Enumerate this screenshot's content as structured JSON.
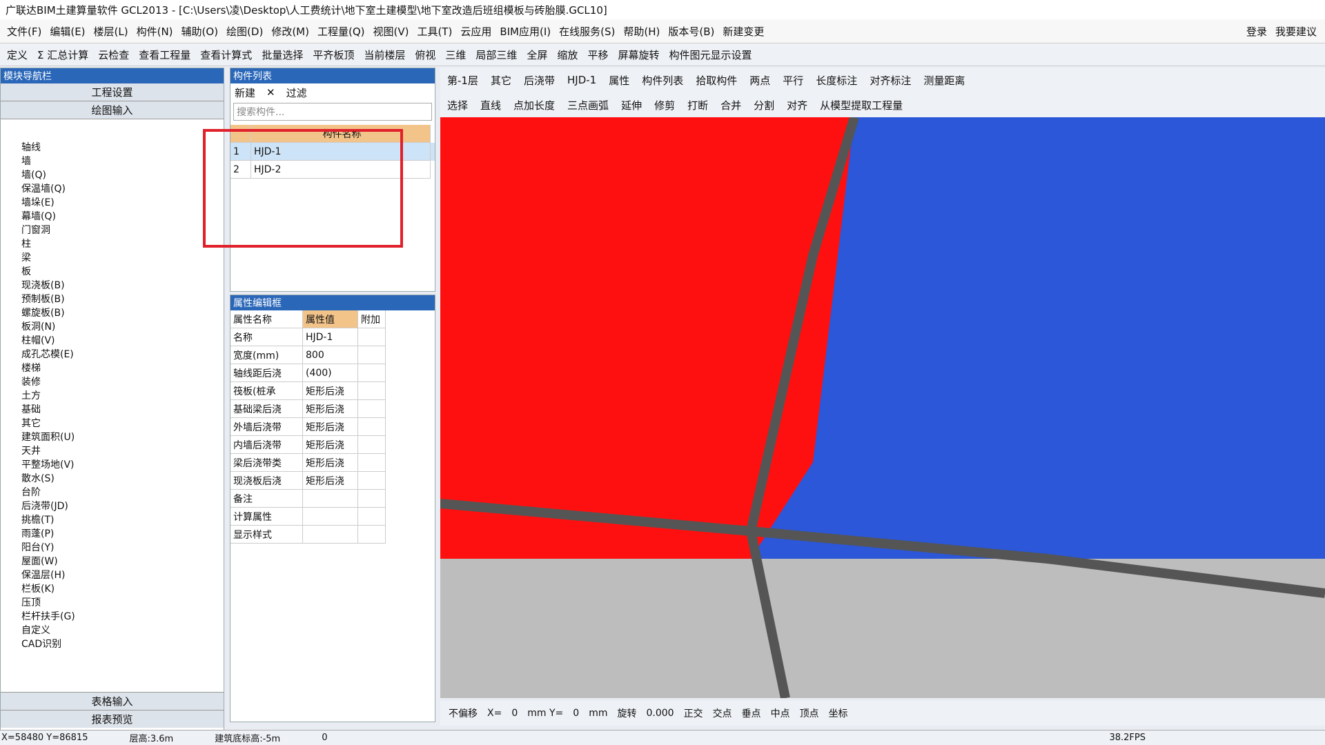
{
  "title": "广联达BIM土建算量软件 GCL2013 - [C:\\Users\\凌\\Desktop\\人工费统计\\地下室土建模型\\地下室改造后班组模板与砖胎膜.GCL10]",
  "menu": [
    "文件(F)",
    "编辑(E)",
    "楼层(L)",
    "构件(N)",
    "辅助(O)",
    "绘图(D)",
    "修改(M)",
    "工程量(Q)",
    "视图(V)",
    "工具(T)",
    "云应用",
    "BIM应用(I)",
    "在线服务(S)",
    "帮助(H)",
    "版本号(B)",
    "新建变更"
  ],
  "right_menu": {
    "login": "登录",
    "suggest": "我要建议"
  },
  "toolbar": [
    "定义",
    "Σ 汇总计算",
    "云检查",
    "查看工程量",
    "查看计算式",
    "批量选择",
    "平齐板顶",
    "当前楼层",
    "俯视",
    "三维",
    "局部三维",
    "全屏",
    "缩放",
    "平移",
    "屏幕旋转",
    "构件图元显示设置"
  ],
  "nav": {
    "header": "模块导航栏",
    "btn1": "工程设置",
    "btn2": "绘图输入",
    "items": [
      "轴线",
      "墙",
      "墙(Q)",
      "保温墙(Q)",
      "墙垛(E)",
      "幕墙(Q)",
      "门窗洞",
      "柱",
      "梁",
      "板",
      "现浇板(B)",
      "预制板(B)",
      "螺旋板(B)",
      "板洞(N)",
      "柱帽(V)",
      "成孔芯模(E)",
      "楼梯",
      "装修",
      "土方",
      "基础",
      "其它",
      "建筑面积(U)",
      "天井",
      "平整场地(V)",
      "散水(S)",
      "台阶",
      "后浇带(JD)",
      "挑檐(T)",
      "雨蓬(P)",
      "阳台(Y)",
      "屋面(W)",
      "保温层(H)",
      "栏板(K)",
      "压顶",
      "栏杆扶手(G)",
      "自定义",
      "CAD识别"
    ],
    "btn3": "表格输入",
    "btn4": "报表预览"
  },
  "comp": {
    "header": "构件列表",
    "new": "新建",
    "filter": "过滤",
    "search": "搜索构件...",
    "col": "构件名称",
    "rows": [
      {
        "n": "1",
        "v": "HJD-1"
      },
      {
        "n": "2",
        "v": "HJD-2"
      }
    ]
  },
  "prop": {
    "header": "属性编辑框",
    "cols": [
      "属性名称",
      "属性值",
      "附加"
    ],
    "rows": [
      [
        "名称",
        "HJD-1"
      ],
      [
        "宽度(mm)",
        "800"
      ],
      [
        "轴线距后浇",
        "(400)"
      ],
      [
        "筏板(桩承",
        "矩形后浇"
      ],
      [
        "基础梁后浇",
        "矩形后浇"
      ],
      [
        "外墙后浇带",
        "矩形后浇"
      ],
      [
        "内墙后浇带",
        "矩形后浇"
      ],
      [
        "梁后浇带类",
        "矩形后浇"
      ],
      [
        "现浇板后浇",
        "矩形后浇"
      ],
      [
        "备注",
        ""
      ],
      [
        "计算属性",
        ""
      ],
      [
        "显示样式",
        ""
      ]
    ]
  },
  "viewbar": {
    "floor": "第-1层",
    "type": "其它",
    "cat": "后浇带",
    "comp": "HJD-1",
    "attr": "属性",
    "list": "构件列表",
    "pick": "拾取构件",
    "two": "两点",
    "para": "平行",
    "len": "长度标注",
    "align": "对齐标注",
    "measure": "测量距离"
  },
  "drawbar": [
    "选择",
    "直线",
    "点加长度",
    "三点画弧",
    "延伸",
    "修剪",
    "打断",
    "合并",
    "分割",
    "对齐",
    "从模型提取工程量"
  ],
  "snap": {
    "move": "不偏移",
    "x": "X=",
    "xv": "0",
    "mm": "mm Y=",
    "yv": "0",
    "mm2": "mm",
    "rot": "旋转",
    "rv": "0.000",
    "items": [
      "正交",
      "交点",
      "垂点",
      "中点",
      "顶点",
      "坐标"
    ]
  },
  "status": {
    "xy": "X=58480 Y=86815",
    "h": "层高:3.6m",
    "base": "建筑底标高:-5m",
    "z": "0",
    "fps": "38.2FPS"
  }
}
